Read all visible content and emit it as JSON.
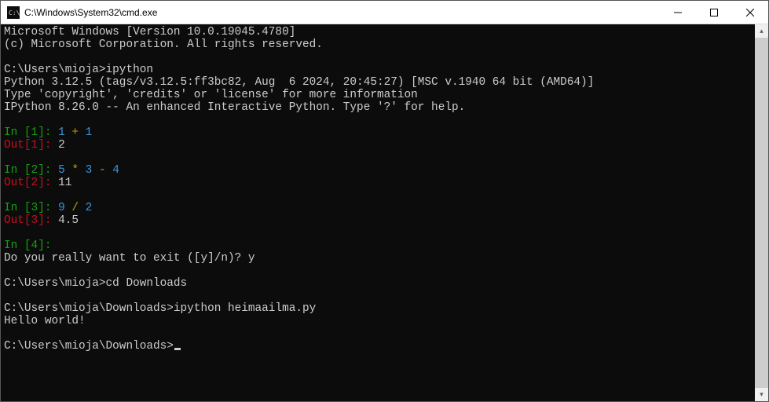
{
  "window": {
    "title": "C:\\Windows\\System32\\cmd.exe",
    "icon_name": "cmd-icon",
    "controls": {
      "minimize": "—",
      "maximize": "▢",
      "close": "✕"
    }
  },
  "scrollbar": {
    "up": "▴",
    "down": "▾"
  },
  "lines": [
    {
      "parts": [
        {
          "cls": "c-w",
          "text": "Microsoft Windows [Version 10.0.19045.4780]"
        }
      ]
    },
    {
      "parts": [
        {
          "cls": "c-w",
          "text": "(c) Microsoft Corporation. All rights reserved."
        }
      ]
    },
    {
      "parts": [
        {
          "cls": "c-w",
          "text": ""
        }
      ]
    },
    {
      "parts": [
        {
          "cls": "c-w",
          "text": "C:\\Users\\mioja>ipython"
        }
      ]
    },
    {
      "parts": [
        {
          "cls": "c-w",
          "text": "Python 3.12.5 (tags/v3.12.5:ff3bc82, Aug  6 2024, 20:45:27) [MSC v.1940 64 bit (AMD64)]"
        }
      ]
    },
    {
      "parts": [
        {
          "cls": "c-w",
          "text": "Type 'copyright', 'credits' or 'license' for more information"
        }
      ]
    },
    {
      "parts": [
        {
          "cls": "c-w",
          "text": "IPython 8.26.0 -- An enhanced Interactive Python. Type '?' for help."
        }
      ]
    },
    {
      "parts": [
        {
          "cls": "c-w",
          "text": ""
        }
      ]
    },
    {
      "parts": [
        {
          "cls": "c-g",
          "text": "In ["
        },
        {
          "cls": "c-g",
          "text": "1"
        },
        {
          "cls": "c-g",
          "text": "]: "
        },
        {
          "cls": "c-c",
          "text": "1"
        },
        {
          "cls": "c-w",
          "text": " "
        },
        {
          "cls": "c-y",
          "text": "+"
        },
        {
          "cls": "c-w",
          "text": " "
        },
        {
          "cls": "c-c",
          "text": "1"
        }
      ]
    },
    {
      "parts": [
        {
          "cls": "c-r",
          "text": "Out["
        },
        {
          "cls": "c-r",
          "text": "1"
        },
        {
          "cls": "c-r",
          "text": "]: "
        },
        {
          "cls": "c-w",
          "text": "2"
        }
      ]
    },
    {
      "parts": [
        {
          "cls": "c-w",
          "text": ""
        }
      ]
    },
    {
      "parts": [
        {
          "cls": "c-g",
          "text": "In ["
        },
        {
          "cls": "c-g",
          "text": "2"
        },
        {
          "cls": "c-g",
          "text": "]: "
        },
        {
          "cls": "c-c",
          "text": "5"
        },
        {
          "cls": "c-w",
          "text": " "
        },
        {
          "cls": "c-y",
          "text": "*"
        },
        {
          "cls": "c-w",
          "text": " "
        },
        {
          "cls": "c-c",
          "text": "3"
        },
        {
          "cls": "c-w",
          "text": " "
        },
        {
          "cls": "c-y",
          "text": "-"
        },
        {
          "cls": "c-w",
          "text": " "
        },
        {
          "cls": "c-c",
          "text": "4"
        }
      ]
    },
    {
      "parts": [
        {
          "cls": "c-r",
          "text": "Out["
        },
        {
          "cls": "c-r",
          "text": "2"
        },
        {
          "cls": "c-r",
          "text": "]: "
        },
        {
          "cls": "c-w",
          "text": "11"
        }
      ]
    },
    {
      "parts": [
        {
          "cls": "c-w",
          "text": ""
        }
      ]
    },
    {
      "parts": [
        {
          "cls": "c-g",
          "text": "In ["
        },
        {
          "cls": "c-g",
          "text": "3"
        },
        {
          "cls": "c-g",
          "text": "]: "
        },
        {
          "cls": "c-c",
          "text": "9"
        },
        {
          "cls": "c-w",
          "text": " "
        },
        {
          "cls": "c-y",
          "text": "/"
        },
        {
          "cls": "c-w",
          "text": " "
        },
        {
          "cls": "c-c",
          "text": "2"
        }
      ]
    },
    {
      "parts": [
        {
          "cls": "c-r",
          "text": "Out["
        },
        {
          "cls": "c-r",
          "text": "3"
        },
        {
          "cls": "c-r",
          "text": "]: "
        },
        {
          "cls": "c-w",
          "text": "4.5"
        }
      ]
    },
    {
      "parts": [
        {
          "cls": "c-w",
          "text": ""
        }
      ]
    },
    {
      "parts": [
        {
          "cls": "c-g",
          "text": "In ["
        },
        {
          "cls": "c-g",
          "text": "4"
        },
        {
          "cls": "c-g",
          "text": "]: "
        }
      ]
    },
    {
      "parts": [
        {
          "cls": "c-w",
          "text": "Do you really want to exit ([y]/n)? y"
        }
      ]
    },
    {
      "parts": [
        {
          "cls": "c-w",
          "text": ""
        }
      ]
    },
    {
      "parts": [
        {
          "cls": "c-w",
          "text": "C:\\Users\\mioja>cd Downloads"
        }
      ]
    },
    {
      "parts": [
        {
          "cls": "c-w",
          "text": ""
        }
      ]
    },
    {
      "parts": [
        {
          "cls": "c-w",
          "text": "C:\\Users\\mioja\\Downloads>ipython heimaailma.py"
        }
      ]
    },
    {
      "parts": [
        {
          "cls": "c-w",
          "text": "Hello world!"
        }
      ]
    },
    {
      "parts": [
        {
          "cls": "c-w",
          "text": ""
        }
      ]
    },
    {
      "parts": [
        {
          "cls": "c-w",
          "text": "C:\\Users\\mioja\\Downloads>"
        }
      ],
      "cursor": true
    }
  ]
}
